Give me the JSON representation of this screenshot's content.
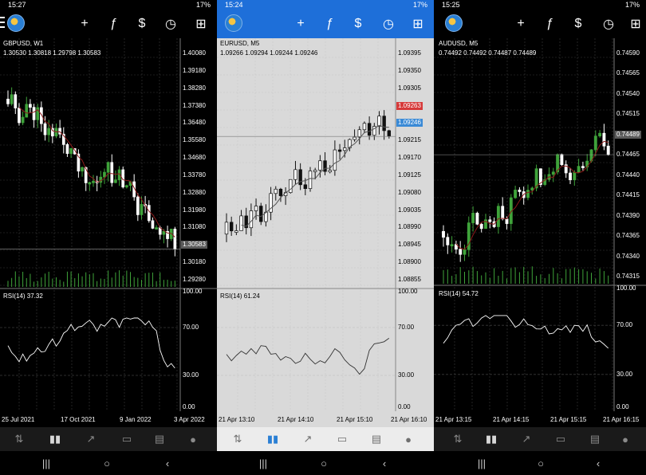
{
  "colors": {
    "dark_bg": "#000000",
    "light_bg": "#d9d9d9",
    "header_blue": "#1e6fd9",
    "bull_candle": "#3fa33a",
    "bear_candle": "#ffffff",
    "ma_line": "#8b1a1a",
    "grid_dark": "#3a3a3a",
    "grid_light": "#c8c8c8",
    "bid_tag_red": "#d63a3a",
    "ask_tag_blue": "#3a8ad6"
  },
  "toolbar_icons": [
    "menu-icon",
    "crosshair-icon",
    "function-icon",
    "currency-icon",
    "clock-icon",
    "add-template-icon"
  ],
  "bottom_tabs": [
    "quotes-icon",
    "chart-icon",
    "trade-icon",
    "history-icon",
    "news-icon",
    "chat-icon"
  ],
  "nav_icons": [
    "recent-apps-icon",
    "home-icon",
    "back-icon"
  ],
  "panels": [
    {
      "id": "gbpusd",
      "theme": "dark",
      "status_time": "15:27",
      "status_right": "17%",
      "symbol": "GBPUSD, W1",
      "ohlc": "1.30530 1.30818 1.29798 1.30583",
      "price_ticks": [
        "1.40080",
        "1.39180",
        "1.38280",
        "1.37380",
        "1.36480",
        "1.35580",
        "1.34680",
        "1.33780",
        "1.32880",
        "1.31980",
        "1.31080",
        "1.30583",
        "1.30180",
        "1.29280"
      ],
      "current_price": "1.30583",
      "rsi_label": "RSI(14) 37.32",
      "rsi_ticks": [
        "100.00",
        "70.00",
        "30.00",
        "0.00"
      ],
      "rsi_value": 37.32,
      "dates": [
        "25 Jul 2021",
        "17 Oct 2021",
        "9 Jan 2022",
        "3 Apr 2022"
      ]
    },
    {
      "id": "eurusd",
      "theme": "light",
      "status_time": "15:24",
      "status_right": "17%",
      "symbol": "EURUSD, M5",
      "ohlc": "1.09266 1.09294 1.09244 1.09246",
      "price_ticks": [
        "1.09395",
        "1.09350",
        "1.09305",
        "1.09263",
        "1.09246",
        "1.09215",
        "1.09170",
        "1.09125",
        "1.09080",
        "1.09035",
        "1.08990",
        "1.08945",
        "1.08900",
        "1.08855"
      ],
      "bid_price": "1.09263",
      "ask_price": "1.09246",
      "rsi_label": "RSI(14) 61.24",
      "rsi_ticks": [
        "100.00",
        "70.00",
        "30.00",
        "0.00"
      ],
      "rsi_value": 61.24,
      "dates": [
        "21 Apr 13:10",
        "21 Apr 14:10",
        "21 Apr 15:10",
        "21 Apr 16:10"
      ]
    },
    {
      "id": "audusd",
      "theme": "dark",
      "status_time": "15:25",
      "status_right": "17%",
      "symbol": "AUDUSD, M5",
      "ohlc": "0.74492 0.74492 0.74487 0.74489",
      "price_ticks": [
        "0.74590",
        "0.74565",
        "0.74540",
        "0.74515",
        "0.74489",
        "0.74465",
        "0.74440",
        "0.74415",
        "0.74390",
        "0.74365",
        "0.74340",
        "0.74315"
      ],
      "current_price": "0.74489",
      "rsi_label": "RSI(14) 54.72",
      "rsi_ticks": [
        "100.00",
        "70.00",
        "30.00",
        "0.00"
      ],
      "rsi_value": 54.72,
      "dates": [
        "21 Apr 13:15",
        "21 Apr 14:15",
        "21 Apr 15:15",
        "21 Apr 16:15"
      ]
    }
  ]
}
